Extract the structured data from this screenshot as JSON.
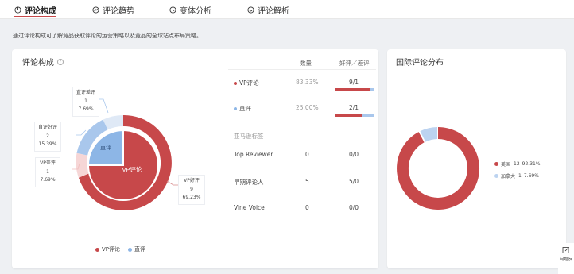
{
  "tabs": [
    {
      "label": "评论构成",
      "icon": "pie-chart-icon",
      "active": true
    },
    {
      "label": "评论趋势",
      "icon": "trend-icon",
      "active": false
    },
    {
      "label": "变体分析",
      "icon": "variant-icon",
      "active": false
    },
    {
      "label": "评论解析",
      "icon": "smile-icon",
      "active": false
    }
  ],
  "description": "通过评论构成可了解竞品获取评论的运营策略以及竞品的全球站点布局策略。",
  "composition": {
    "title": "评论构成",
    "table_headers": {
      "count": "数量",
      "ratio": "好评／差评"
    },
    "rows": [
      {
        "label": "VP评论",
        "percent": "83.33%",
        "ratio": "9/1",
        "color": "#c7484a"
      },
      {
        "label": "直评",
        "percent": "25.00%",
        "ratio": "2/1",
        "color": "#8db6e6"
      }
    ],
    "reviewer_section": "亚马逊标签",
    "reviewer_rows": [
      {
        "label": "Top Reviewer",
        "count": "0",
        "ratio": "0/0"
      },
      {
        "label": "早期评论人",
        "count": "5",
        "ratio": "5/0"
      },
      {
        "label": "Vine Voice",
        "count": "0",
        "ratio": "0/0"
      }
    ],
    "donut_inner": {
      "vp_label": "VP评论",
      "direct_label": "直评"
    },
    "callouts": [
      {
        "name": "直评差评",
        "count": "1",
        "percent": "7.69%"
      },
      {
        "name": "直评好评",
        "count": "2",
        "percent": "15.39%"
      },
      {
        "name": "VP差评",
        "count": "1",
        "percent": "7.69%"
      },
      {
        "name": "VP好评",
        "count": "9",
        "percent": "69.23%"
      }
    ],
    "legend": [
      {
        "label": "VP评论",
        "color": "#c7484a"
      },
      {
        "label": "直评",
        "color": "#8db6e6"
      }
    ]
  },
  "international": {
    "title": "国际评论分布",
    "legend": [
      {
        "label": "美国",
        "count": "12",
        "percent": "92.31%",
        "color": "#c7484a"
      },
      {
        "label": "加拿大",
        "count": "1",
        "percent": "7.69%",
        "color": "#bcd3f0"
      }
    ]
  },
  "side_widget": {
    "label": "问题反"
  },
  "colors": {
    "accent": "#c7484a",
    "direct": "#8db6e6",
    "vp_light": "#f6d6d6",
    "direct_light": "#dfe9f6"
  }
}
